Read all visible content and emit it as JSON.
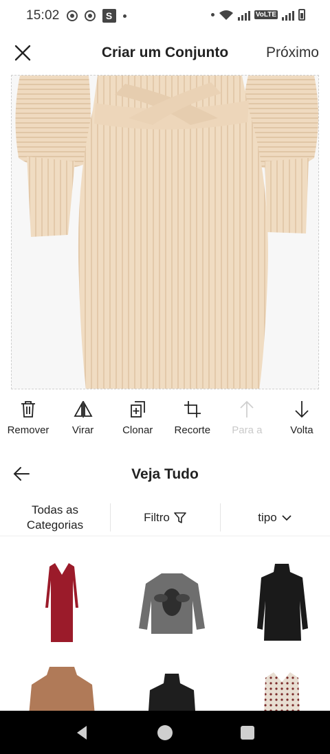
{
  "status_bar": {
    "time": "15:02",
    "s_badge": "S",
    "volte": "VoLTE"
  },
  "header": {
    "title": "Criar um Conjunto",
    "next_label": "Próximo"
  },
  "tools": [
    {
      "label": "Remover",
      "icon": "trash-icon",
      "enabled": true
    },
    {
      "label": "Virar",
      "icon": "flip-icon",
      "enabled": true
    },
    {
      "label": "Clonar",
      "icon": "clone-icon",
      "enabled": true
    },
    {
      "label": "Recorte",
      "icon": "crop-icon",
      "enabled": true
    },
    {
      "label": "Para a",
      "icon": "arrow-up-icon",
      "enabled": false
    },
    {
      "label": "Volta",
      "icon": "arrow-down-icon",
      "enabled": true
    }
  ],
  "browse": {
    "title": "Veja Tudo",
    "categories_label": "Todas as Categorias",
    "filter_label": "Filtro",
    "type_label": "tipo"
  },
  "products": [
    {
      "name": "red-dress",
      "color": "#9b1b2a"
    },
    {
      "name": "grey-bee-sweater",
      "color": "#6e6e6e"
    },
    {
      "name": "black-turtleneck-dress",
      "color": "#1a1a1a"
    },
    {
      "name": "brown-cable-sweater",
      "color": "#b07a58"
    },
    {
      "name": "black-turtleneck-top",
      "color": "#1e1e1e"
    },
    {
      "name": "pattern-dress",
      "color": "#e8ded2"
    }
  ],
  "colors": {
    "dress": "#f0dcc2",
    "dress_shadow": "#e3c9aa",
    "disabled_text": "#c9c9c9"
  }
}
